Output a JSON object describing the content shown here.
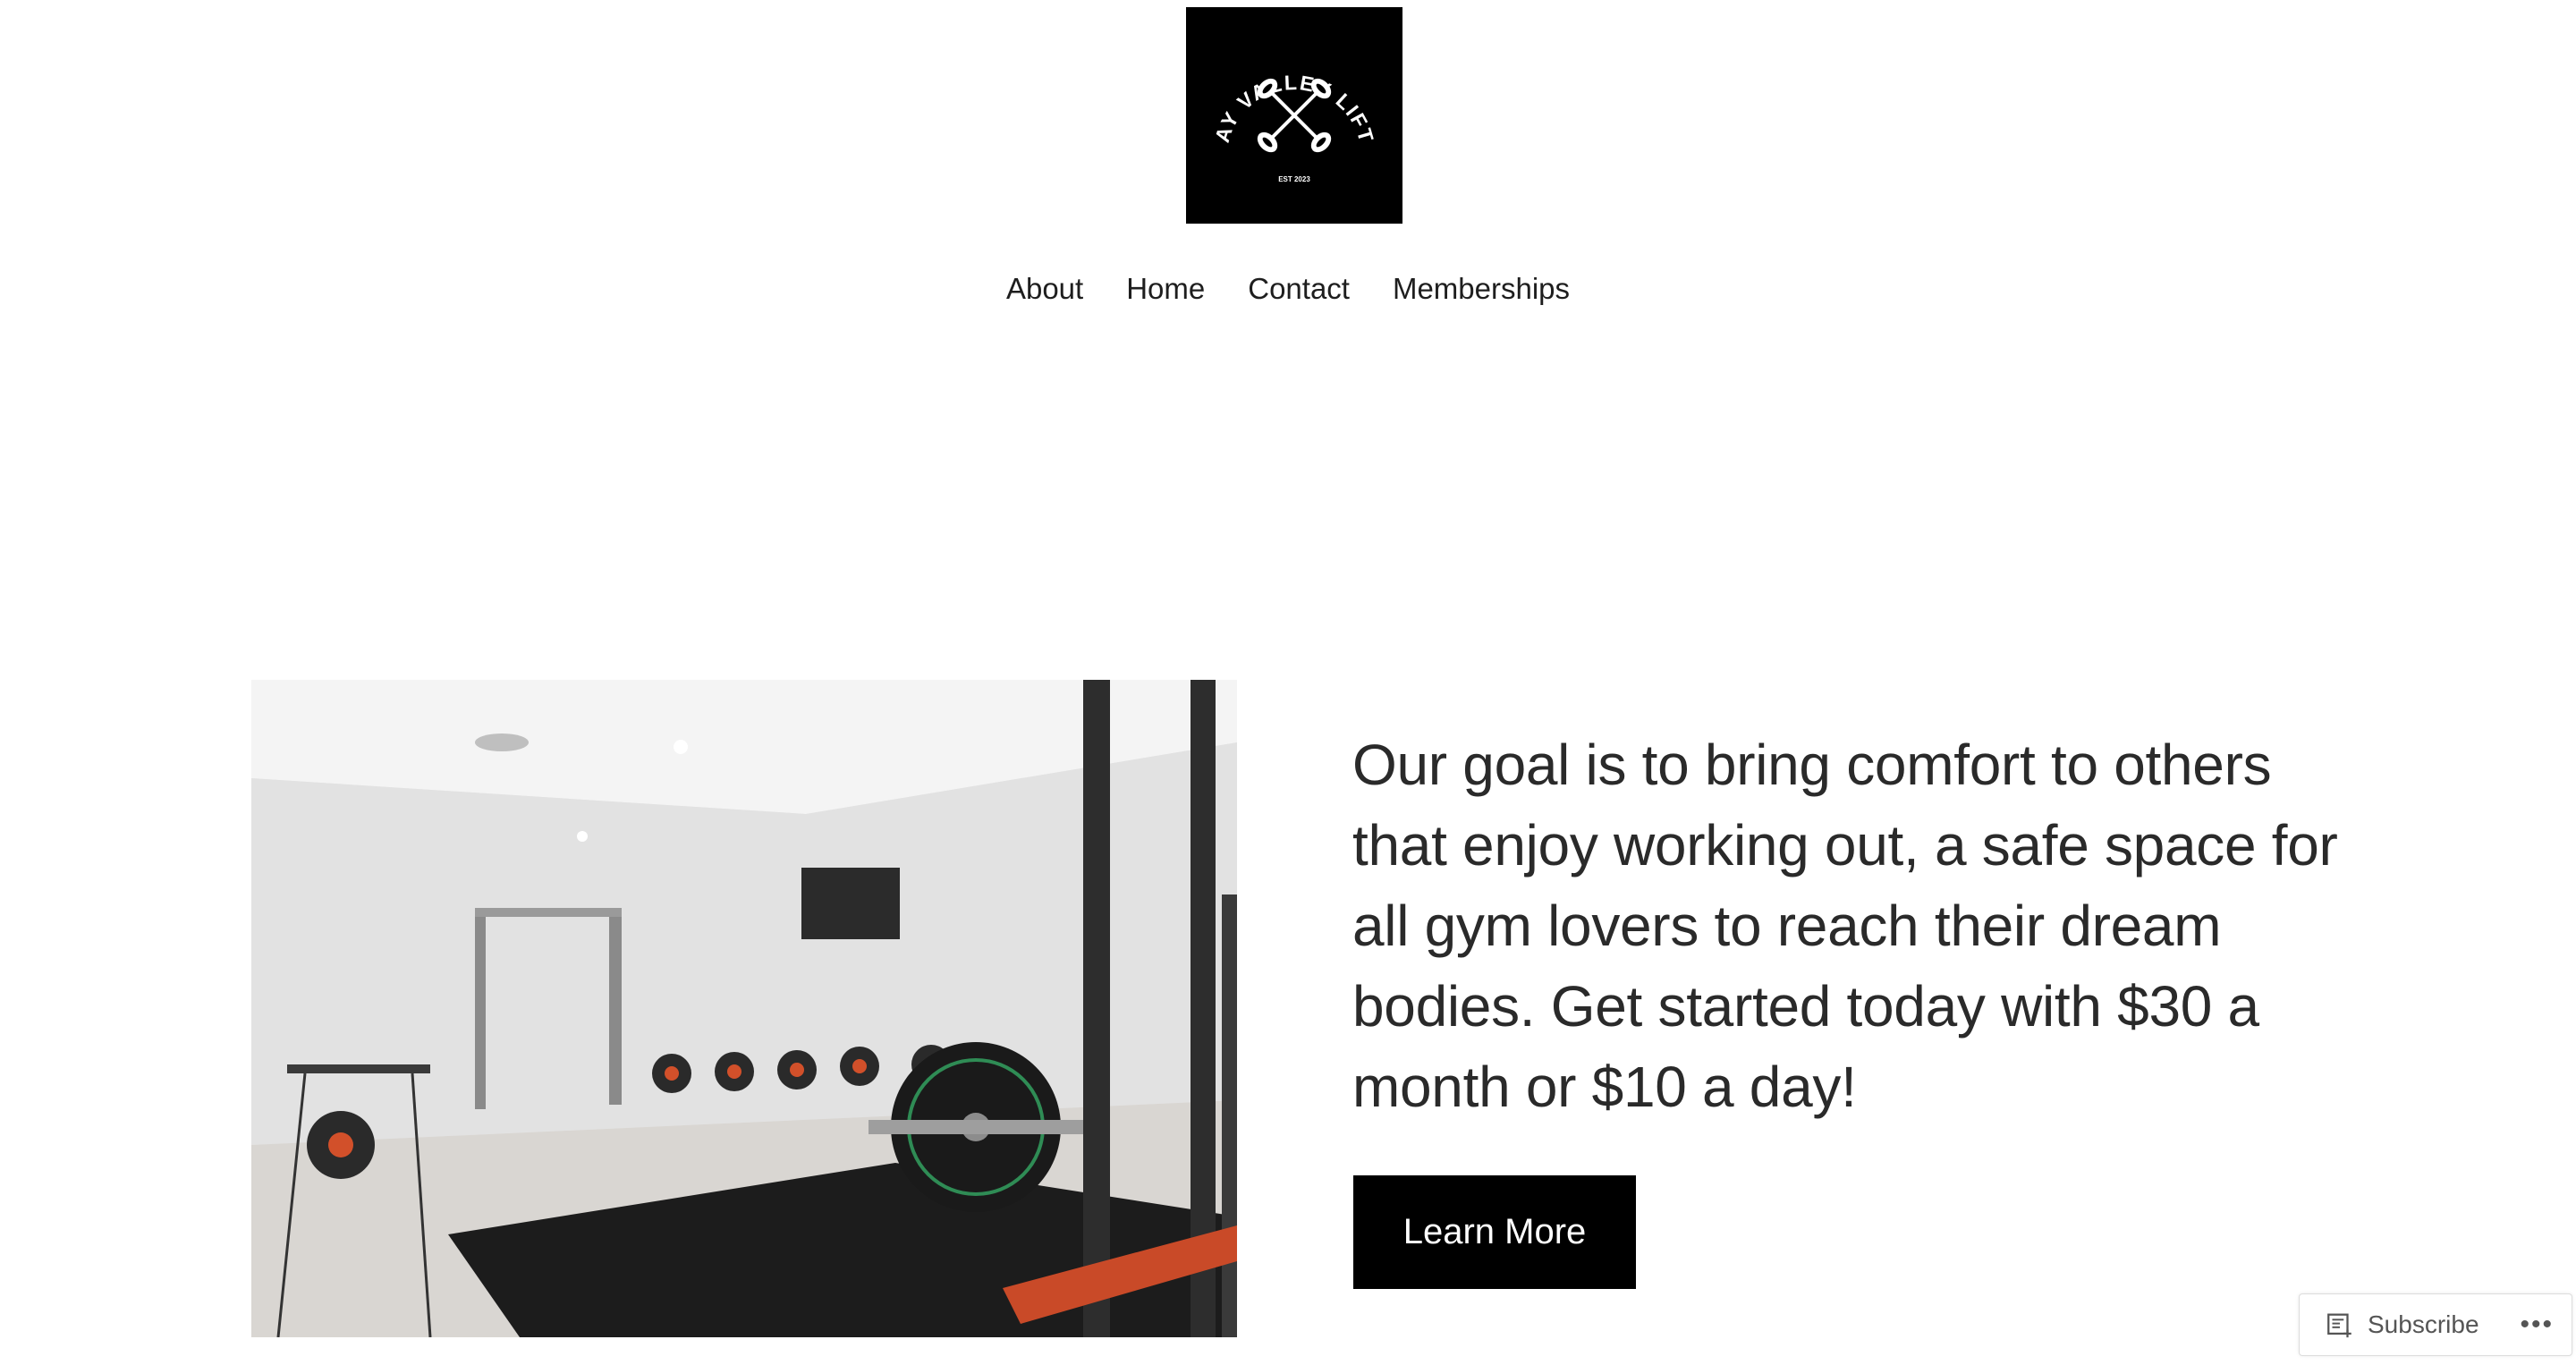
{
  "brand": {
    "logo_text": "BAY VALLEY LIFTS",
    "logo_subtext": "EST 2023",
    "logo_icon": "crossed-barbells-icon"
  },
  "nav": {
    "items": [
      {
        "label": "About"
      },
      {
        "label": "Home"
      },
      {
        "label": "Contact"
      },
      {
        "label": "Memberships"
      }
    ]
  },
  "hero": {
    "image_icon": "gym-interior-photo",
    "text": "Our goal is to bring comfort to others that enjoy working out, a safe space for all gym lovers to reach their dream bodies. Get started today with $30 a month or $10 a day!",
    "cta_label": "Learn More"
  },
  "subscribe": {
    "label": "Subscribe",
    "icon": "reader-icon",
    "more_label": "•••"
  },
  "colors": {
    "background": "#ffffff",
    "text": "#222222",
    "button_bg": "#000000",
    "button_text": "#ffffff"
  }
}
